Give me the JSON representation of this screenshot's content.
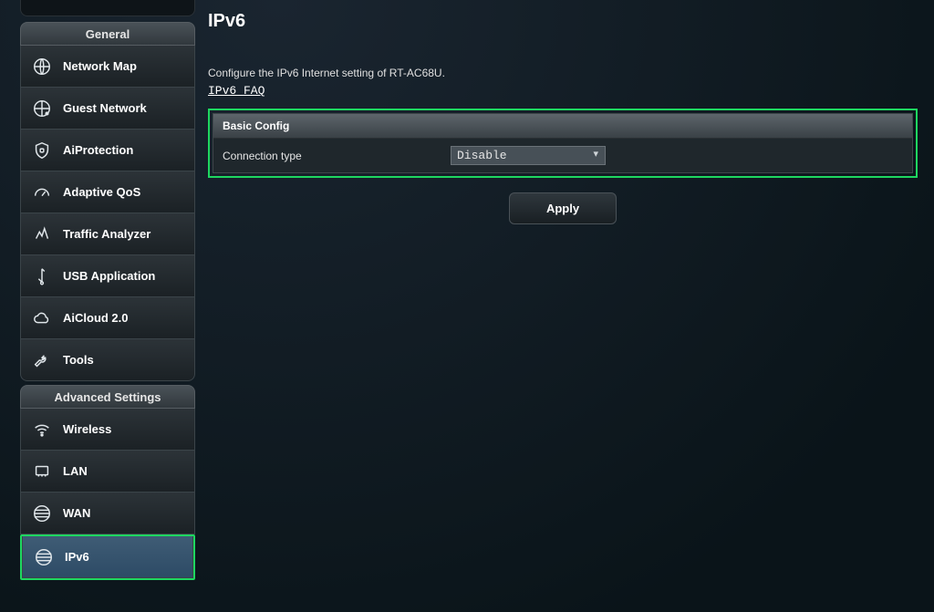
{
  "sidebar": {
    "group1_title": "General",
    "group2_title": "Advanced Settings",
    "items_general": [
      {
        "label": "Network Map",
        "icon": "globe-grid"
      },
      {
        "label": "Guest Network",
        "icon": "globe-people"
      },
      {
        "label": "AiProtection",
        "icon": "shield-lock"
      },
      {
        "label": "Adaptive QoS",
        "icon": "gauge"
      },
      {
        "label": "Traffic Analyzer",
        "icon": "traffic"
      },
      {
        "label": "USB Application",
        "icon": "usb"
      },
      {
        "label": "AiCloud 2.0",
        "icon": "cloud"
      },
      {
        "label": "Tools",
        "icon": "wrench"
      }
    ],
    "items_advanced": [
      {
        "label": "Wireless",
        "icon": "wifi"
      },
      {
        "label": "LAN",
        "icon": "lan"
      },
      {
        "label": "WAN",
        "icon": "globe-lines"
      },
      {
        "label": "IPv6",
        "icon": "globe-lines",
        "active": true
      }
    ]
  },
  "main": {
    "title": "IPv6",
    "subtitle": "Configure the IPv6 Internet setting of RT-AC68U.",
    "faq_label": "IPv6 FAQ",
    "config_header": "Basic Config",
    "connection_type_label": "Connection type",
    "connection_type_value": "Disable",
    "apply_label": "Apply"
  }
}
